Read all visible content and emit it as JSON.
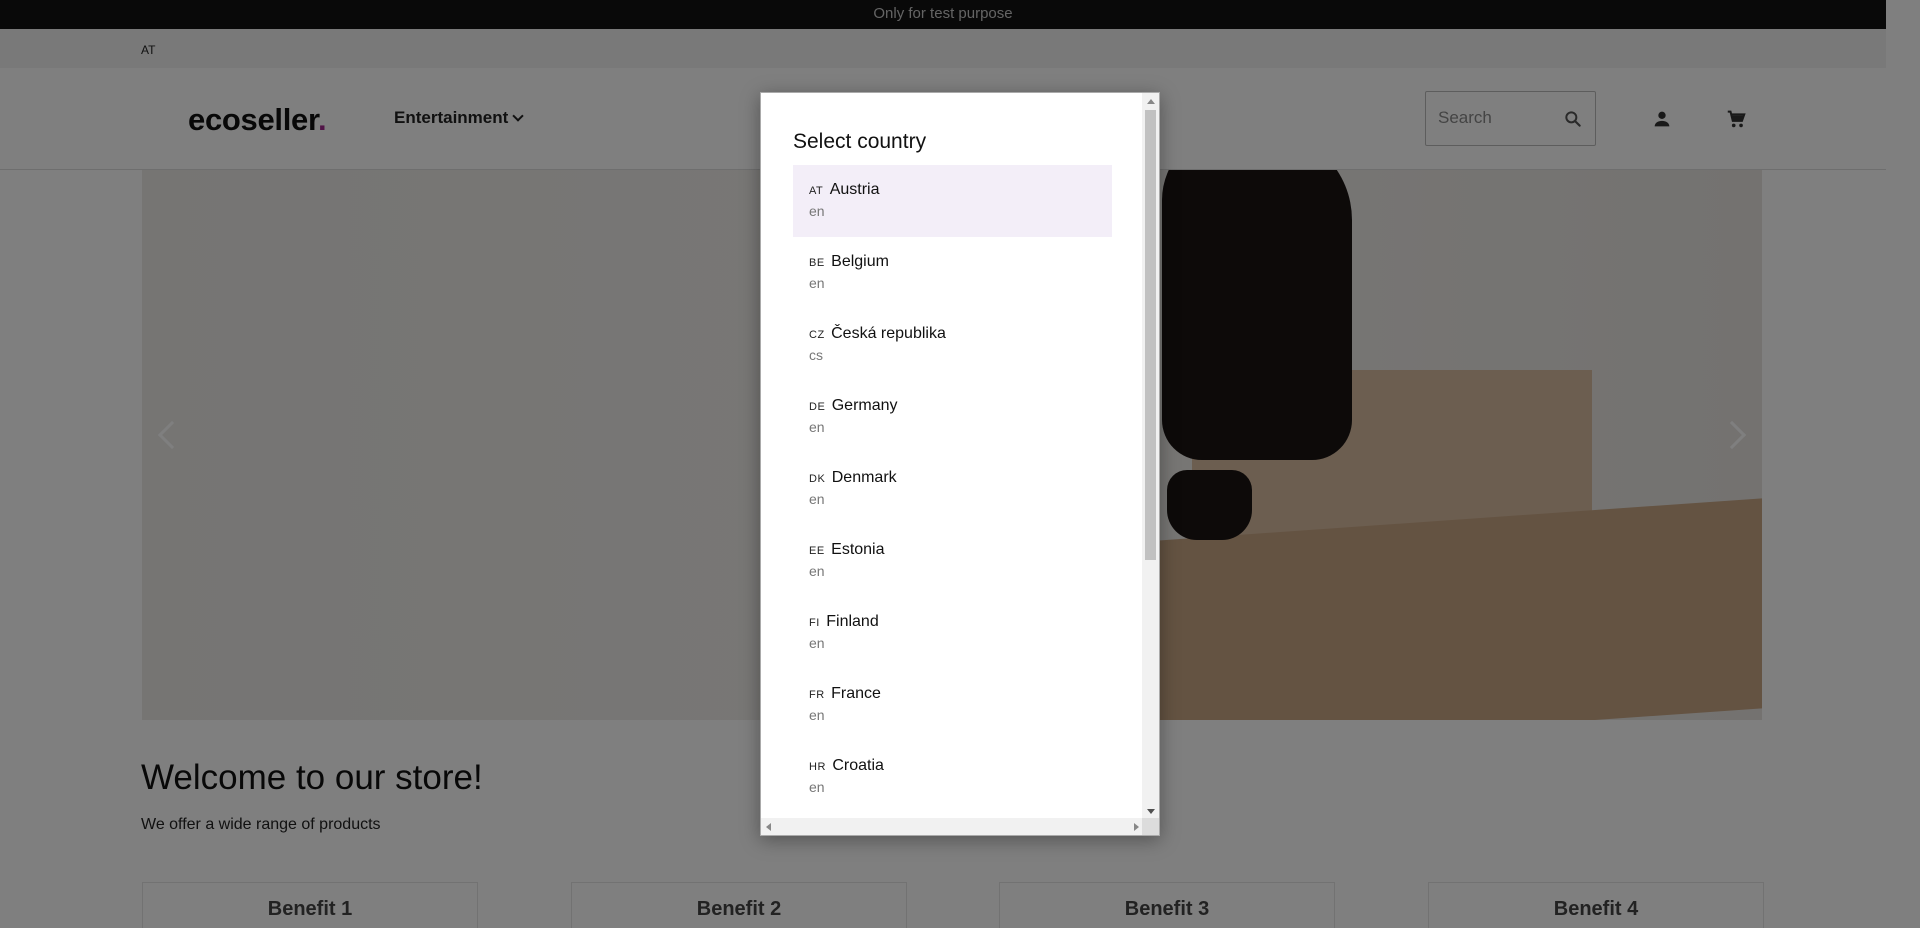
{
  "topbar": {
    "text": "Only for test purpose"
  },
  "country_strip": {
    "code": "AT"
  },
  "header": {
    "logo_text": "ecoseller",
    "logo_dot": ".",
    "nav_label": "Entertainment",
    "search_placeholder": "Search",
    "icons": {
      "search": "search-icon",
      "user": "user-icon",
      "cart": "cart-icon",
      "chevron": "chevron-down-icon"
    }
  },
  "hero": {
    "icons": {
      "prev": "chevron-left-icon",
      "next": "chevron-right-icon"
    }
  },
  "welcome": {
    "title": "Welcome to our store!",
    "subtitle": "We offer a wide range of products"
  },
  "benefits": [
    "Benefit 1",
    "Benefit 2",
    "Benefit 3",
    "Benefit 4"
  ],
  "modal": {
    "title": "Select country",
    "countries": [
      {
        "code": "AT",
        "name": "Austria",
        "lang": "en"
      },
      {
        "code": "BE",
        "name": "Belgium",
        "lang": "en"
      },
      {
        "code": "CZ",
        "name": "Česká republika",
        "lang": "cs"
      },
      {
        "code": "DE",
        "name": "Germany",
        "lang": "en"
      },
      {
        "code": "DK",
        "name": "Denmark",
        "lang": "en"
      },
      {
        "code": "EE",
        "name": "Estonia",
        "lang": "en"
      },
      {
        "code": "FI",
        "name": "Finland",
        "lang": "en"
      },
      {
        "code": "FR",
        "name": "France",
        "lang": "en"
      },
      {
        "code": "HR",
        "name": "Croatia",
        "lang": "en"
      }
    ],
    "selected_code": "AT"
  },
  "colors": {
    "accent": "#a3288f",
    "selected_bg": "#f3eef8",
    "topbar_bg": "#121212"
  }
}
